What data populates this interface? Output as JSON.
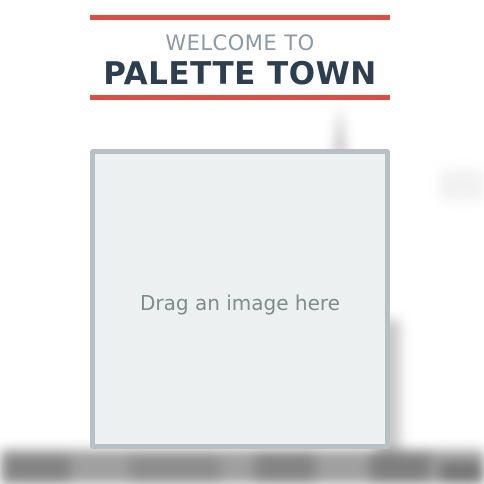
{
  "header": {
    "welcome": "WELCOME TO",
    "title": "PALETTE TOWN"
  },
  "dropzone": {
    "label": "Drag an image here"
  },
  "colors": {
    "accent_rule": "#e24b3f",
    "title": "#2c3e50",
    "welcome": "#8a9aa6",
    "dropzone_bg": "#ecf0f1",
    "dropzone_border": "#b7c0c4",
    "dropzone_text": "#7f8c8d"
  }
}
